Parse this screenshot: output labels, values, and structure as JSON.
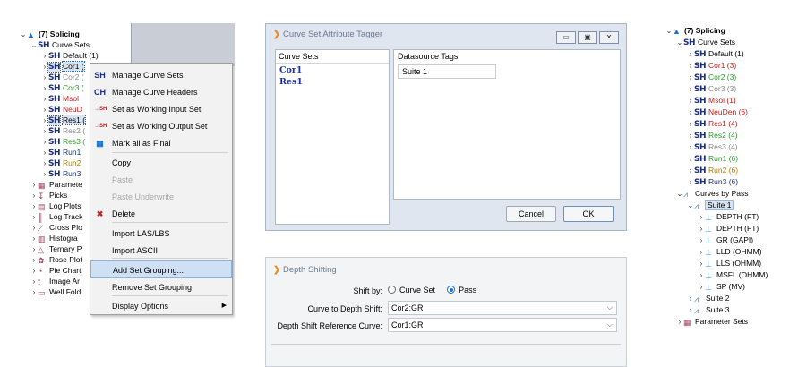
{
  "left_tree": {
    "root_label": "(7) Splicing",
    "curve_sets_label": "Curve Sets",
    "items": [
      {
        "label": "Default (1)",
        "color": "#000000"
      },
      {
        "label": "Cor1 (",
        "color": "#000000",
        "selected": true
      },
      {
        "label": "Cor2 (",
        "color": "#8a8a8a"
      },
      {
        "label": "Cor3 (",
        "color": "#2a9a2a"
      },
      {
        "label": "Msol",
        "color": "#c02020"
      },
      {
        "label": "NeuD",
        "color": "#c02020"
      },
      {
        "label": "Res1 (",
        "color": "#000000",
        "selected": true
      },
      {
        "label": "Res2 (",
        "color": "#8a8a8a"
      },
      {
        "label": "Res3 (",
        "color": "#2a9a2a"
      },
      {
        "label": "Run1",
        "color": "#1a2e7a"
      },
      {
        "label": "Run2",
        "color": "#b08000"
      },
      {
        "label": "Run3",
        "color": "#1a2e7a"
      }
    ],
    "other_items": [
      "Paramete",
      "Picks",
      "Log Plots",
      "Log Track",
      "Cross Plo",
      "Histogra",
      "Ternary P",
      "Rose Plot",
      "Pie Chart",
      "Image Ar",
      "Well Fold"
    ]
  },
  "context_menu": {
    "items": [
      {
        "label": "Manage Curve Sets",
        "icon": "SH",
        "disabled": false
      },
      {
        "label": "Manage Curve Headers",
        "icon": "CH",
        "disabled": false
      },
      {
        "label": "Set as Working Input Set",
        "icon": "→SH",
        "disabled": false
      },
      {
        "label": "Set as Working Output Set",
        "icon": "→SH",
        "disabled": false
      },
      {
        "label": "Mark all as Final",
        "icon": "final-icon",
        "disabled": false
      },
      {
        "label": "Copy",
        "disabled": false
      },
      {
        "label": "Paste",
        "disabled": true
      },
      {
        "label": "Paste Underwrite",
        "disabled": true
      },
      {
        "label": "Delete",
        "icon": "✖",
        "disabled": false
      },
      {
        "label": "Import LAS/LBS",
        "disabled": false
      },
      {
        "label": "Import ASCII",
        "disabled": false
      },
      {
        "label": "Add Set Grouping...",
        "disabled": false,
        "hover": true
      },
      {
        "label": "Remove Set Grouping",
        "disabled": false
      },
      {
        "label": "Display Options",
        "disabled": false,
        "submenu": true
      }
    ]
  },
  "tagger_dialog": {
    "title": "Curve Set Attribute Tagger",
    "curve_sets_header": "Curve Sets",
    "datasource_tags_header": "Datasource Tags",
    "curve_sets": [
      "Cor1",
      "Res1"
    ],
    "tag_value": "Suite 1",
    "cancel_label": "Cancel",
    "ok_label": "OK",
    "win_min": "▭",
    "win_max": "▣",
    "win_close": "✕"
  },
  "depth_dialog": {
    "title": "Depth Shifting",
    "shift_by_label": "Shift by:",
    "option_curve_set": "Curve Set",
    "option_pass": "Pass",
    "selected_option": "Pass",
    "curve_label": "Curve to Depth Shift:",
    "curve_value": "Cor2:GR",
    "ref_label": "Depth Shift Reference Curve:",
    "ref_value": "Cor1:GR"
  },
  "right_tree": {
    "root_label": "(7) Splicing",
    "curve_sets_label": "Curve Sets",
    "sets": [
      {
        "label": "Default (1)",
        "color": "#000000"
      },
      {
        "label": "Cor1 (3)",
        "color": "#c02020"
      },
      {
        "label": "Cor2 (3)",
        "color": "#2a9a2a"
      },
      {
        "label": "Cor3 (3)",
        "color": "#8a8a8a"
      },
      {
        "label": "Msol (1)",
        "color": "#c02020"
      },
      {
        "label": "NeuDen (6)",
        "color": "#c02020"
      },
      {
        "label": "Res1 (4)",
        "color": "#c02020"
      },
      {
        "label": "Res2 (4)",
        "color": "#2a9a2a"
      },
      {
        "label": "Res3 (4)",
        "color": "#8a8a8a"
      },
      {
        "label": "Run1 (6)",
        "color": "#2a9a2a"
      },
      {
        "label": "Run2 (6)",
        "color": "#b08000"
      },
      {
        "label": "Run3 (6)",
        "color": "#1a2e7a"
      }
    ],
    "curves_by_pass_label": "Curves by Pass",
    "suite1_label": "Suite 1",
    "suite1_curves": [
      "DEPTH (FT)",
      "DEPTH (FT)",
      "GR (GAPI)",
      "LLD (OHMM)",
      "LLS (OHMM)",
      "MSFL (OHMM)",
      "SP (MV)"
    ],
    "suite2_label": "Suite 2",
    "suite3_label": "Suite 3",
    "parameter_sets_label": "Parameter Sets"
  }
}
